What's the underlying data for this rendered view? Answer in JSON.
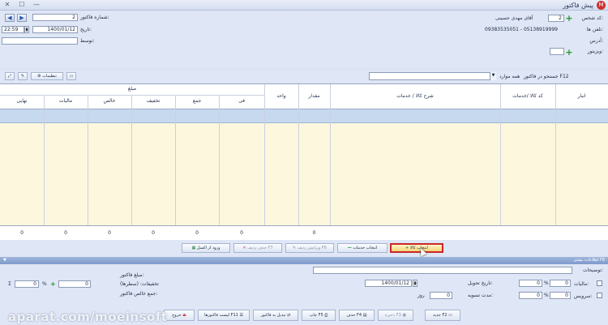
{
  "window": {
    "title": "پیش فاکتور",
    "logo_glyph": "M"
  },
  "header": {
    "customer_code_label": "کد شخص:",
    "customer_code_value": "2",
    "customer_name": "آقای مهدی حسینی",
    "phone_label": "تلفن ها:",
    "phone_value": "09383535051 - 05138919999",
    "address_label": "آدرس:",
    "visitor_label": "ویزیتور:",
    "invoice_no_label": "شماره فاکتور:",
    "invoice_no_value": "2",
    "date_label": "تاریخ:",
    "date_value": "1400/01/12",
    "time_value": "22:59",
    "by_label": "توسط:"
  },
  "toolbar": {
    "settings_label": "تنظیمات",
    "search_label": "جستجو در فاکتور F12",
    "search_scope": "همه موارد"
  },
  "grid": {
    "group_header": "مبلغ",
    "columns": {
      "warehouse": "انبار",
      "code": "کد کالا /خدمات",
      "desc": "شرح کالا / خدمات",
      "qty": "مقدار",
      "unit": "واحد",
      "fee": "فی",
      "sum": "جمع",
      "discount": "تخفیف",
      "net": "خالص",
      "tax": "مالیات",
      "final": "نهایی"
    },
    "totals": {
      "qty": "0",
      "fee": "0",
      "sum": "0",
      "discount": "0",
      "net": "0",
      "tax": "0",
      "final": "0"
    }
  },
  "actions": {
    "select_goods": "انتخاب کالا",
    "select_services": "انتخاب خدمات",
    "edit_row": "ویرایش ردیف F6",
    "delete_row": "حذف ردیف F7",
    "excel_import": "ورود از اکسل"
  },
  "more_info": {
    "label": "F8 اطلاعات بیشتر"
  },
  "details": {
    "notes_label": "توضیحات:",
    "delivery_date_label": "تاریخ تحویل:",
    "delivery_date_value": "1400/01/12",
    "tax_label": "مالیات:",
    "service_label": "سرویس:",
    "settle_label": "مدت تسویه:",
    "settle_value": "0",
    "settle_unit": "روز",
    "invoice_amount_label": "مبلغ فاکتور:",
    "row_discounts_label": "تخفیفات: (سطرها)",
    "net_total_label": "جمع خالص فاکتور:",
    "pct_value": "0",
    "pct_sign": "%",
    "amount_value": "0",
    "sigma": "Σ"
  },
  "footer": {
    "new": "جدید F2",
    "save": "ذخیره F3",
    "delete": "حذف F4",
    "print": "چاپ F5",
    "convert": "تبدیل به فاکتور",
    "list": "لیست فاکتورها F11",
    "exit": "خروج"
  },
  "watermark": "aparat.com/moeinsoft"
}
